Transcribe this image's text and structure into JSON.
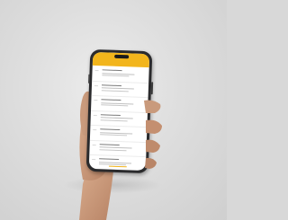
{
  "scene": {
    "description_colors": {
      "background": "#d8d8d8",
      "skin": "#c99a7c",
      "phone_frame": "#2a2a2c",
      "app_accent": "#f2b51c",
      "screen": "#ffffff"
    }
  },
  "phone": {
    "list_items": [
      {
        "id": 1
      },
      {
        "id": 2
      },
      {
        "id": 3
      },
      {
        "id": 4
      },
      {
        "id": 5
      },
      {
        "id": 6
      },
      {
        "id": 7
      },
      {
        "id": 8
      }
    ]
  }
}
